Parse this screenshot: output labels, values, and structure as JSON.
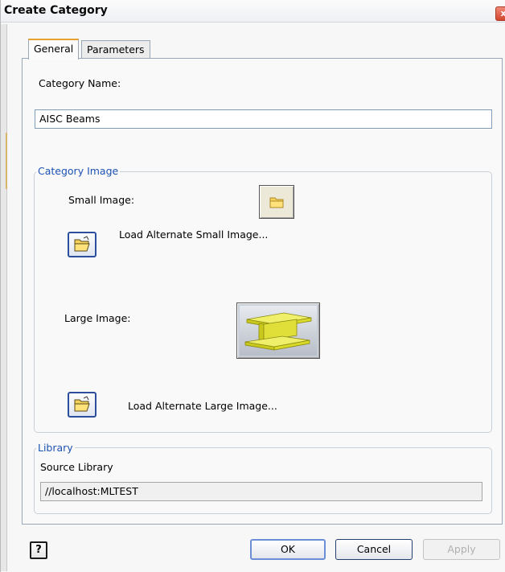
{
  "window": {
    "title": "Create Category",
    "close_glyph": "x"
  },
  "tabs": [
    {
      "label": "General",
      "active": true
    },
    {
      "label": "Parameters",
      "active": false
    }
  ],
  "general": {
    "category_name_label": "Category Name:",
    "category_name_value": "AISC Beams",
    "category_image": {
      "legend": "Category Image",
      "small_image_label": "Small Image:",
      "small_image_icon": "folder-icon",
      "load_small_label": "Load Alternate Small Image...",
      "large_image_label": "Large Image:",
      "large_image_icon": "i-beam-icon",
      "load_large_label": "Load Alternate Large Image..."
    },
    "library": {
      "legend": "Library",
      "source_label": "Source Library",
      "source_value": "//localhost:MLTEST"
    }
  },
  "footer": {
    "help_glyph": "?",
    "ok_label": "OK",
    "cancel_label": "Cancel",
    "apply_label": "Apply"
  },
  "colors": {
    "accent": "#1d52b3",
    "tab_highlight": "#e6a22c",
    "beam": "#d9d92a"
  }
}
